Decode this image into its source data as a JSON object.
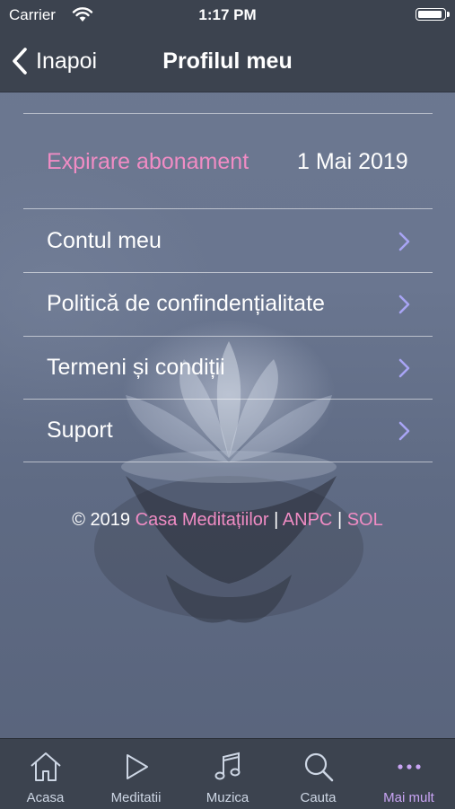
{
  "status_bar": {
    "carrier": "Carrier",
    "time": "1:17 PM",
    "battery_level": 0.95
  },
  "nav": {
    "back_label": "Inapoi",
    "title": "Profilul meu"
  },
  "subscription": {
    "label": "Expirare abonament",
    "value": "1 Mai 2019"
  },
  "menu": [
    {
      "label": "Contul meu",
      "icon": "chevron-right-icon"
    },
    {
      "label": "Politică de confindențialitate",
      "icon": "chevron-right-icon"
    },
    {
      "label": "Termeni și condiții",
      "icon": "chevron-right-icon"
    },
    {
      "label": "Suport",
      "icon": "chevron-right-icon"
    }
  ],
  "footer": {
    "copyright": "© 2019",
    "link1": "Casa Meditațiilor",
    "sep": "|",
    "link2": "ANPC",
    "link3": "SOL"
  },
  "tabs": [
    {
      "label": "Acasa",
      "icon": "home-icon"
    },
    {
      "label": "Meditatii",
      "icon": "play-icon"
    },
    {
      "label": "Muzica",
      "icon": "music-note-icon"
    },
    {
      "label": "Cauta",
      "icon": "search-icon"
    },
    {
      "label": "Mai mult",
      "icon": "more-icon",
      "active": true
    }
  ],
  "colors": {
    "accent_pink": "#f08cc4",
    "tab_active": "#c9a4f4",
    "bar_bg": "#3c434f",
    "chevron": "#a8a4f4"
  }
}
